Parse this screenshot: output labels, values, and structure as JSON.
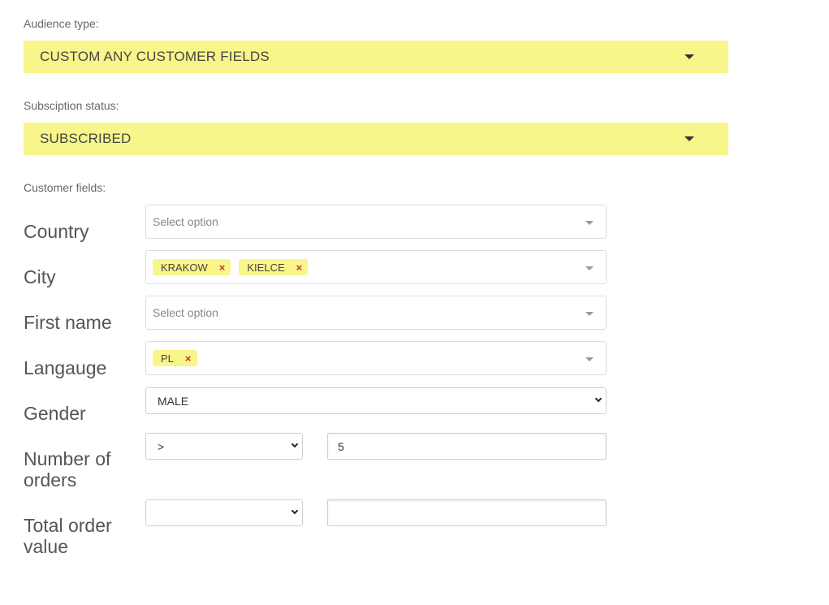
{
  "audience": {
    "label": "Audience type:",
    "value": "CUSTOM ANY CUSTOMER FIELDS"
  },
  "subscription": {
    "label": "Subsciption status:",
    "value": "SUBSCRIBED"
  },
  "customer_fields": {
    "label": "Customer fields:",
    "country": {
      "label": "Country",
      "placeholder": "Select option"
    },
    "city": {
      "label": "City",
      "tags": [
        "KRAKOW",
        "KIELCE"
      ]
    },
    "first_name": {
      "label": "First name",
      "placeholder": "Select option"
    },
    "language": {
      "label": "Langauge",
      "tags": [
        "PL"
      ]
    },
    "gender": {
      "label": "Gender",
      "value": "MALE"
    },
    "number_of_orders": {
      "label": "Number of orders",
      "operator": ">",
      "value": "5"
    },
    "total_order_value": {
      "label": "Total order value",
      "operator": "",
      "value": ""
    }
  },
  "icons": {
    "tag_remove": "×"
  },
  "colors": {
    "highlight": "#f8f58a",
    "remove": "#c0392b"
  }
}
